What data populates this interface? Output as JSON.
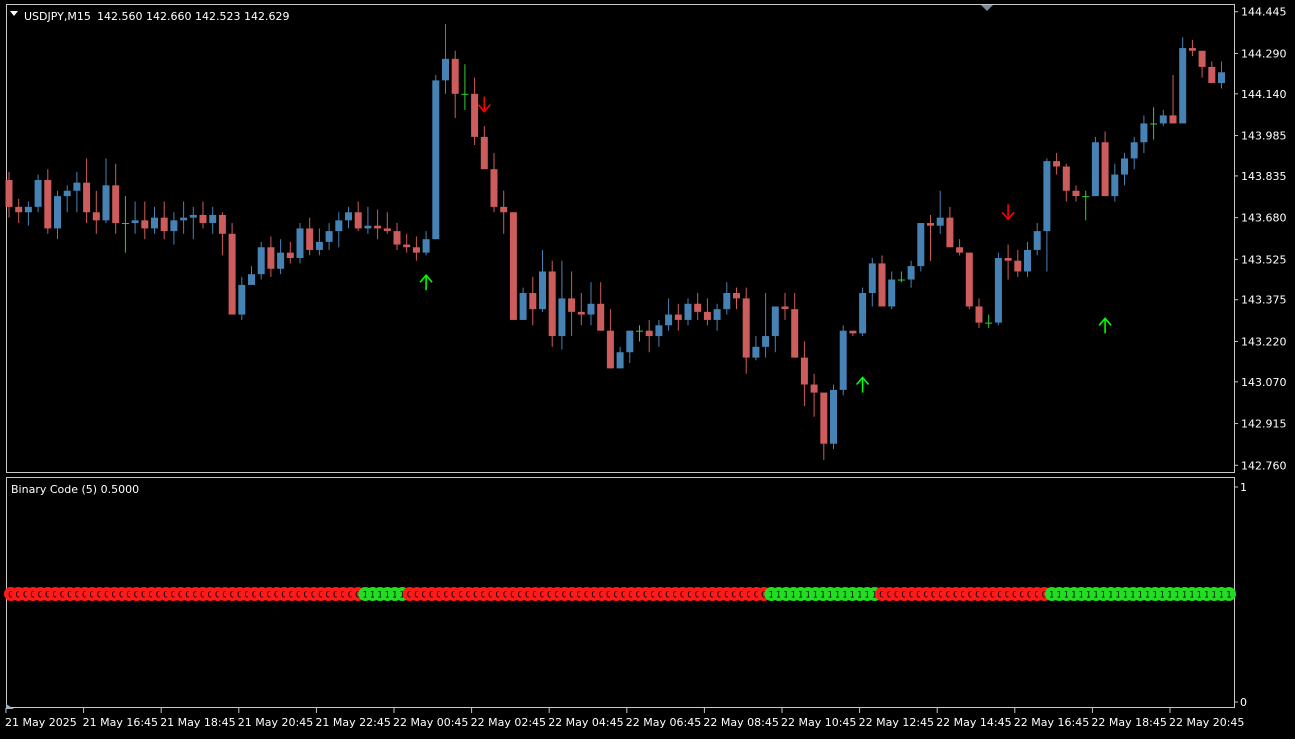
{
  "main_header": {
    "symbol": "USDJPY,M15",
    "ohlc": "142.560 142.660 142.523 142.629"
  },
  "indicator_header": {
    "title": "Binary Code (5) 0.5000"
  },
  "colors": {
    "bull": "#4682B4",
    "bear": "#CD5C5C",
    "doji": "#32CD32",
    "up_arrow": "#00FF00",
    "down_arrow": "#FF0000",
    "one_fill": "#22DD22",
    "zero_fill": "#FF1A1A"
  },
  "chart_data": [
    {
      "type": "candlestick",
      "y_tick_labels": [
        "144.445",
        "144.290",
        "144.140",
        "143.985",
        "143.835",
        "143.680",
        "143.525",
        "143.375",
        "143.220",
        "143.070",
        "142.915",
        "142.760"
      ],
      "ylim": [
        142.735,
        144.47
      ],
      "x_tick_labels": [
        "21 May 2025",
        "21 May 16:45",
        "21 May 18:45",
        "21 May 20:45",
        "21 May 22:45",
        "22 May 00:45",
        "22 May 02:45",
        "22 May 04:45",
        "22 May 06:45",
        "22 May 08:45",
        "22 May 10:45",
        "22 May 12:45",
        "22 May 14:45",
        "22 May 16:45",
        "22 May 18:45",
        "22 May 20:45"
      ],
      "x_tick_index": [
        0,
        8,
        16,
        24,
        32,
        40,
        48,
        56,
        64,
        72,
        80,
        88,
        96,
        104,
        112,
        120
      ],
      "ohlc": [
        [
          143.82,
          143.85,
          143.68,
          143.72
        ],
        [
          143.72,
          143.75,
          143.66,
          143.7
        ],
        [
          143.7,
          143.74,
          143.65,
          143.72
        ],
        [
          143.72,
          143.84,
          143.7,
          143.82
        ],
        [
          143.82,
          143.86,
          143.62,
          143.64
        ],
        [
          143.64,
          143.78,
          143.6,
          143.76
        ],
        [
          143.76,
          143.8,
          143.7,
          143.78
        ],
        [
          143.78,
          143.85,
          143.7,
          143.81
        ],
        [
          143.81,
          143.9,
          143.66,
          143.7
        ],
        [
          143.7,
          143.78,
          143.62,
          143.67
        ],
        [
          143.67,
          143.9,
          143.66,
          143.8
        ],
        [
          143.8,
          143.88,
          143.62,
          143.66
        ],
        [
          143.66,
          143.76,
          143.55,
          143.66
        ],
        [
          143.66,
          143.74,
          143.62,
          143.67
        ],
        [
          143.67,
          143.74,
          143.6,
          143.64
        ],
        [
          143.64,
          143.72,
          143.62,
          143.68
        ],
        [
          143.68,
          143.74,
          143.6,
          143.63
        ],
        [
          143.63,
          143.7,
          143.58,
          143.67
        ],
        [
          143.67,
          143.74,
          143.62,
          143.68
        ],
        [
          143.68,
          143.72,
          143.6,
          143.69
        ],
        [
          143.69,
          143.74,
          143.64,
          143.66
        ],
        [
          143.66,
          143.72,
          143.62,
          143.69
        ],
        [
          143.69,
          143.7,
          143.54,
          143.62
        ],
        [
          143.62,
          143.66,
          143.32,
          143.32
        ],
        [
          143.32,
          143.46,
          143.3,
          143.43
        ],
        [
          143.43,
          143.5,
          143.44,
          143.47
        ],
        [
          143.47,
          143.59,
          143.45,
          143.57
        ],
        [
          143.57,
          143.61,
          143.46,
          143.49
        ],
        [
          143.49,
          143.6,
          143.47,
          143.55
        ],
        [
          143.55,
          143.59,
          143.51,
          143.53
        ],
        [
          143.53,
          143.66,
          143.51,
          143.64
        ],
        [
          143.64,
          143.68,
          143.54,
          143.56
        ],
        [
          143.56,
          143.64,
          143.54,
          143.59
        ],
        [
          143.59,
          143.66,
          143.56,
          143.63
        ],
        [
          143.63,
          143.7,
          143.57,
          143.67
        ],
        [
          143.67,
          143.72,
          143.64,
          143.7
        ],
        [
          143.7,
          143.74,
          143.63,
          143.64
        ],
        [
          143.64,
          143.72,
          143.62,
          143.65
        ],
        [
          143.65,
          143.71,
          143.6,
          143.64
        ],
        [
          143.64,
          143.7,
          143.62,
          143.63
        ],
        [
          143.63,
          143.66,
          143.56,
          143.58
        ],
        [
          143.58,
          143.62,
          143.55,
          143.57
        ],
        [
          143.57,
          143.61,
          143.52,
          143.55
        ],
        [
          143.55,
          143.63,
          143.54,
          143.6
        ],
        [
          143.6,
          144.21,
          143.6,
          144.19
        ],
        [
          144.19,
          144.4,
          144.14,
          144.27
        ],
        [
          144.27,
          144.3,
          144.05,
          144.14
        ],
        [
          144.14,
          144.25,
          144.08,
          144.14
        ],
        [
          144.14,
          144.2,
          143.95,
          143.98
        ],
        [
          143.98,
          144.02,
          143.86,
          143.86
        ],
        [
          143.86,
          143.92,
          143.7,
          143.72
        ],
        [
          143.72,
          143.78,
          143.62,
          143.7
        ],
        [
          143.7,
          143.7,
          143.3,
          143.3
        ],
        [
          143.3,
          143.42,
          143.3,
          143.4
        ],
        [
          143.4,
          143.46,
          143.28,
          143.34
        ],
        [
          143.34,
          143.56,
          143.33,
          143.48
        ],
        [
          143.48,
          143.52,
          143.2,
          143.24
        ],
        [
          143.24,
          143.52,
          143.19,
          143.38
        ],
        [
          143.38,
          143.48,
          143.24,
          143.33
        ],
        [
          143.33,
          143.4,
          143.28,
          143.32
        ],
        [
          143.32,
          143.44,
          143.28,
          143.36
        ],
        [
          143.36,
          143.44,
          143.26,
          143.26
        ],
        [
          143.26,
          143.34,
          143.12,
          143.12
        ],
        [
          143.12,
          143.2,
          143.12,
          143.18
        ],
        [
          143.18,
          143.26,
          143.14,
          143.26
        ],
        [
          143.26,
          143.28,
          143.22,
          143.26
        ],
        [
          143.26,
          143.3,
          143.18,
          143.24
        ],
        [
          143.24,
          143.3,
          143.2,
          143.28
        ],
        [
          143.28,
          143.38,
          143.26,
          143.32
        ],
        [
          143.32,
          143.36,
          143.26,
          143.3
        ],
        [
          143.3,
          143.38,
          143.28,
          143.36
        ],
        [
          143.36,
          143.4,
          143.3,
          143.33
        ],
        [
          143.33,
          143.38,
          143.28,
          143.3
        ],
        [
          143.3,
          143.36,
          143.26,
          143.34
        ],
        [
          143.34,
          143.44,
          143.32,
          143.4
        ],
        [
          143.4,
          143.42,
          143.34,
          143.38
        ],
        [
          143.38,
          143.42,
          143.1,
          143.16
        ],
        [
          143.16,
          143.24,
          143.15,
          143.2
        ],
        [
          143.2,
          143.4,
          143.16,
          143.24
        ],
        [
          143.24,
          143.34,
          143.18,
          143.35
        ],
        [
          143.35,
          143.4,
          143.3,
          143.34
        ],
        [
          143.34,
          143.4,
          143.16,
          143.16
        ],
        [
          143.16,
          143.22,
          142.98,
          143.06
        ],
        [
          143.06,
          143.1,
          142.94,
          143.03
        ],
        [
          143.03,
          143.03,
          142.78,
          142.84
        ],
        [
          142.84,
          143.06,
          142.82,
          143.04
        ],
        [
          143.04,
          143.28,
          143.02,
          143.26
        ],
        [
          143.26,
          143.26,
          143.24,
          143.25
        ],
        [
          143.25,
          143.42,
          143.24,
          143.4
        ],
        [
          143.4,
          143.53,
          143.35,
          143.51
        ],
        [
          143.51,
          143.54,
          143.35,
          143.35
        ],
        [
          143.35,
          143.48,
          143.34,
          143.45
        ],
        [
          143.45,
          143.48,
          143.44,
          143.45
        ],
        [
          143.45,
          143.52,
          143.42,
          143.5
        ],
        [
          143.5,
          143.66,
          143.48,
          143.66
        ],
        [
          143.66,
          143.69,
          143.52,
          143.65
        ],
        [
          143.65,
          143.78,
          143.62,
          143.68
        ],
        [
          143.68,
          143.72,
          143.57,
          143.57
        ],
        [
          143.57,
          143.6,
          143.54,
          143.55
        ],
        [
          143.55,
          143.55,
          143.34,
          143.35
        ],
        [
          143.35,
          143.38,
          143.27,
          143.29
        ],
        [
          143.29,
          143.32,
          143.27,
          143.29
        ],
        [
          143.29,
          143.55,
          143.28,
          143.53
        ],
        [
          143.53,
          143.58,
          143.45,
          143.52
        ],
        [
          143.52,
          143.56,
          143.46,
          143.48
        ],
        [
          143.48,
          143.59,
          143.46,
          143.56
        ],
        [
          143.56,
          143.66,
          143.54,
          143.63
        ],
        [
          143.63,
          143.9,
          143.48,
          143.89
        ],
        [
          143.89,
          143.92,
          143.84,
          143.87
        ],
        [
          143.87,
          143.88,
          143.74,
          143.78
        ],
        [
          143.78,
          143.8,
          143.74,
          143.76
        ],
        [
          143.76,
          143.78,
          143.67,
          143.76
        ],
        [
          143.76,
          143.98,
          143.76,
          143.96
        ],
        [
          143.96,
          144.0,
          143.76,
          143.76
        ],
        [
          143.76,
          143.88,
          143.74,
          143.84
        ],
        [
          143.84,
          143.92,
          143.8,
          143.9
        ],
        [
          143.9,
          143.98,
          143.86,
          143.96
        ],
        [
          143.96,
          144.06,
          143.92,
          144.03
        ],
        [
          144.03,
          144.09,
          143.97,
          144.03
        ],
        [
          144.03,
          144.08,
          144.02,
          144.06
        ],
        [
          144.06,
          144.21,
          144.05,
          144.03
        ],
        [
          144.03,
          144.35,
          144.08,
          144.31
        ],
        [
          144.31,
          144.34,
          144.28,
          144.3
        ],
        [
          144.3,
          144.3,
          144.2,
          144.24
        ],
        [
          144.24,
          144.26,
          144.18,
          144.18
        ],
        [
          144.18,
          144.26,
          144.16,
          144.22
        ]
      ],
      "up_arrows": [
        {
          "index": 43,
          "price": 143.44
        },
        {
          "index": 88,
          "price": 143.06
        },
        {
          "index": 113,
          "price": 143.28
        }
      ],
      "down_arrows": [
        {
          "index": 49,
          "price": 144.1
        },
        {
          "index": 103,
          "price": 143.7
        }
      ]
    },
    {
      "type": "binary-series",
      "y_tick_labels": [
        "1",
        "0"
      ],
      "ylim": [
        0,
        1
      ],
      "digits": "0000000000000000000000000000000000000000000000001111110000000000000000000000000000000000000000000000000111111111111111000000000000000000000001111111111111111111111111"
    }
  ]
}
